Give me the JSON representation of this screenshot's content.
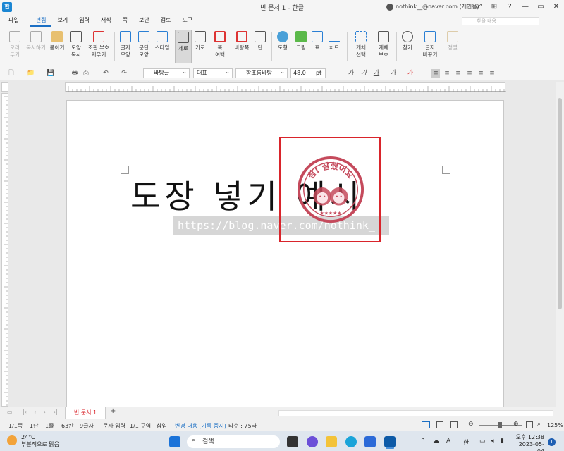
{
  "window": {
    "title": "빈 문서 1 - 한글",
    "account": "nothink__@naver.com (개인용)",
    "app_icon": "한"
  },
  "menu": {
    "items": [
      "파일",
      "편집",
      "보기",
      "입력",
      "서식",
      "쪽",
      "보안",
      "검토",
      "도구"
    ],
    "active": "편집",
    "search_placeholder": "찾을 내용"
  },
  "ribbon": {
    "buttons": [
      {
        "label": "오려\n두기",
        "icon": "scissors-icon",
        "disabled": true
      },
      {
        "label": "복사하기",
        "icon": "copy-icon",
        "disabled": true
      },
      {
        "label": "붙이기",
        "icon": "paste-icon",
        "disabled": false
      },
      {
        "label": "모양\n복사",
        "icon": "format-painter-icon",
        "disabled": false
      },
      {
        "label": "조판 부호\n지우기",
        "icon": "clear-marks-icon",
        "disabled": false
      },
      {
        "label": "글자\n모양",
        "icon": "char-shape-icon",
        "disabled": false
      },
      {
        "label": "문단\n모양",
        "icon": "para-shape-icon",
        "disabled": false
      },
      {
        "label": "스타일",
        "icon": "style-icon",
        "disabled": false
      },
      {
        "label": "세로",
        "icon": "portrait-icon",
        "disabled": false,
        "selected": true
      },
      {
        "label": "가로",
        "icon": "landscape-icon",
        "disabled": false
      },
      {
        "label": "쪽\n여백",
        "icon": "margin-icon",
        "disabled": false
      },
      {
        "label": "바탕쪽",
        "icon": "master-page-icon",
        "disabled": false
      },
      {
        "label": "단",
        "icon": "columns-icon",
        "disabled": false
      },
      {
        "label": "도형",
        "icon": "shape-icon",
        "disabled": false
      },
      {
        "label": "그림",
        "icon": "picture-icon",
        "disabled": false
      },
      {
        "label": "표",
        "icon": "table-icon",
        "disabled": false
      },
      {
        "label": "차트",
        "icon": "chart-icon",
        "disabled": false
      },
      {
        "label": "개체\n선택",
        "icon": "object-select-icon",
        "disabled": false
      },
      {
        "label": "개체\n보호",
        "icon": "object-protect-icon",
        "disabled": false
      },
      {
        "label": "찾기",
        "icon": "find-icon",
        "disabled": false
      },
      {
        "label": "글자\n바꾸기",
        "icon": "char-convert-icon",
        "disabled": false
      },
      {
        "label": "정렬",
        "icon": "sort-icon",
        "disabled": true
      }
    ]
  },
  "format_bar": {
    "style": "바탕글",
    "language": "대표",
    "font": "함초롬바탕",
    "size": "48.0",
    "size_unit": "pt"
  },
  "document": {
    "text": "도장 넣기 예시",
    "watermark": "https://blog.naver.com/nothink_",
    "stamp_text": "참! 잘했어요",
    "stamp_stars": "★★★★★"
  },
  "tabs": {
    "doc_tab": "빈 문서 1",
    "add_label": "+"
  },
  "status": {
    "page": "1/1쪽",
    "column": "1단",
    "line": "1줄",
    "col_pos": "63칸",
    "chars": "9글자",
    "mode": "문자 입력",
    "section": "1/1 구역",
    "insert": "삽입",
    "track": "변경 내용 [기록 중지]",
    "typing": "타수 : 75타",
    "zoom": "125%"
  },
  "taskbar": {
    "temp": "24°C",
    "weather": "부분적으로 맑음",
    "search": "검색",
    "ime_a": "A",
    "ime_han": "한",
    "time": "오후 12:38",
    "date": "2023-05-04",
    "notifications": "1"
  },
  "colors": {
    "accent": "#1b6fc4",
    "stamp_red": "#d9242b",
    "stamp_ink": "#c54a5c"
  }
}
